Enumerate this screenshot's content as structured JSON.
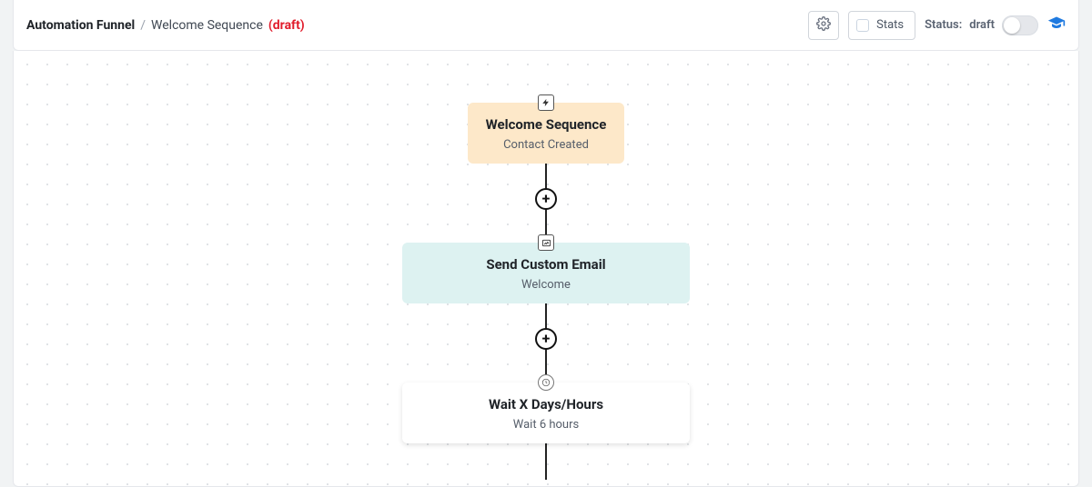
{
  "breadcrumb": {
    "root": "Automation Funnel",
    "separator": "/",
    "name": "Welcome Sequence",
    "draft_label": "(draft)"
  },
  "toolbar": {
    "settings_icon": "gear",
    "stats_label": "Stats",
    "status_prefix": "Status:",
    "status_value": "draft",
    "help_icon": "graduation-cap"
  },
  "flow": {
    "nodes": [
      {
        "kind": "trigger",
        "head_icon": "bolt",
        "title": "Welcome Sequence",
        "subtitle": "Contact Created"
      },
      {
        "kind": "email",
        "head_icon": "mail-image",
        "title": "Send Custom Email",
        "subtitle": "Welcome"
      },
      {
        "kind": "wait",
        "head_icon": "clock",
        "title": "Wait X Days/Hours",
        "subtitle": "Wait 6 hours"
      }
    ]
  }
}
